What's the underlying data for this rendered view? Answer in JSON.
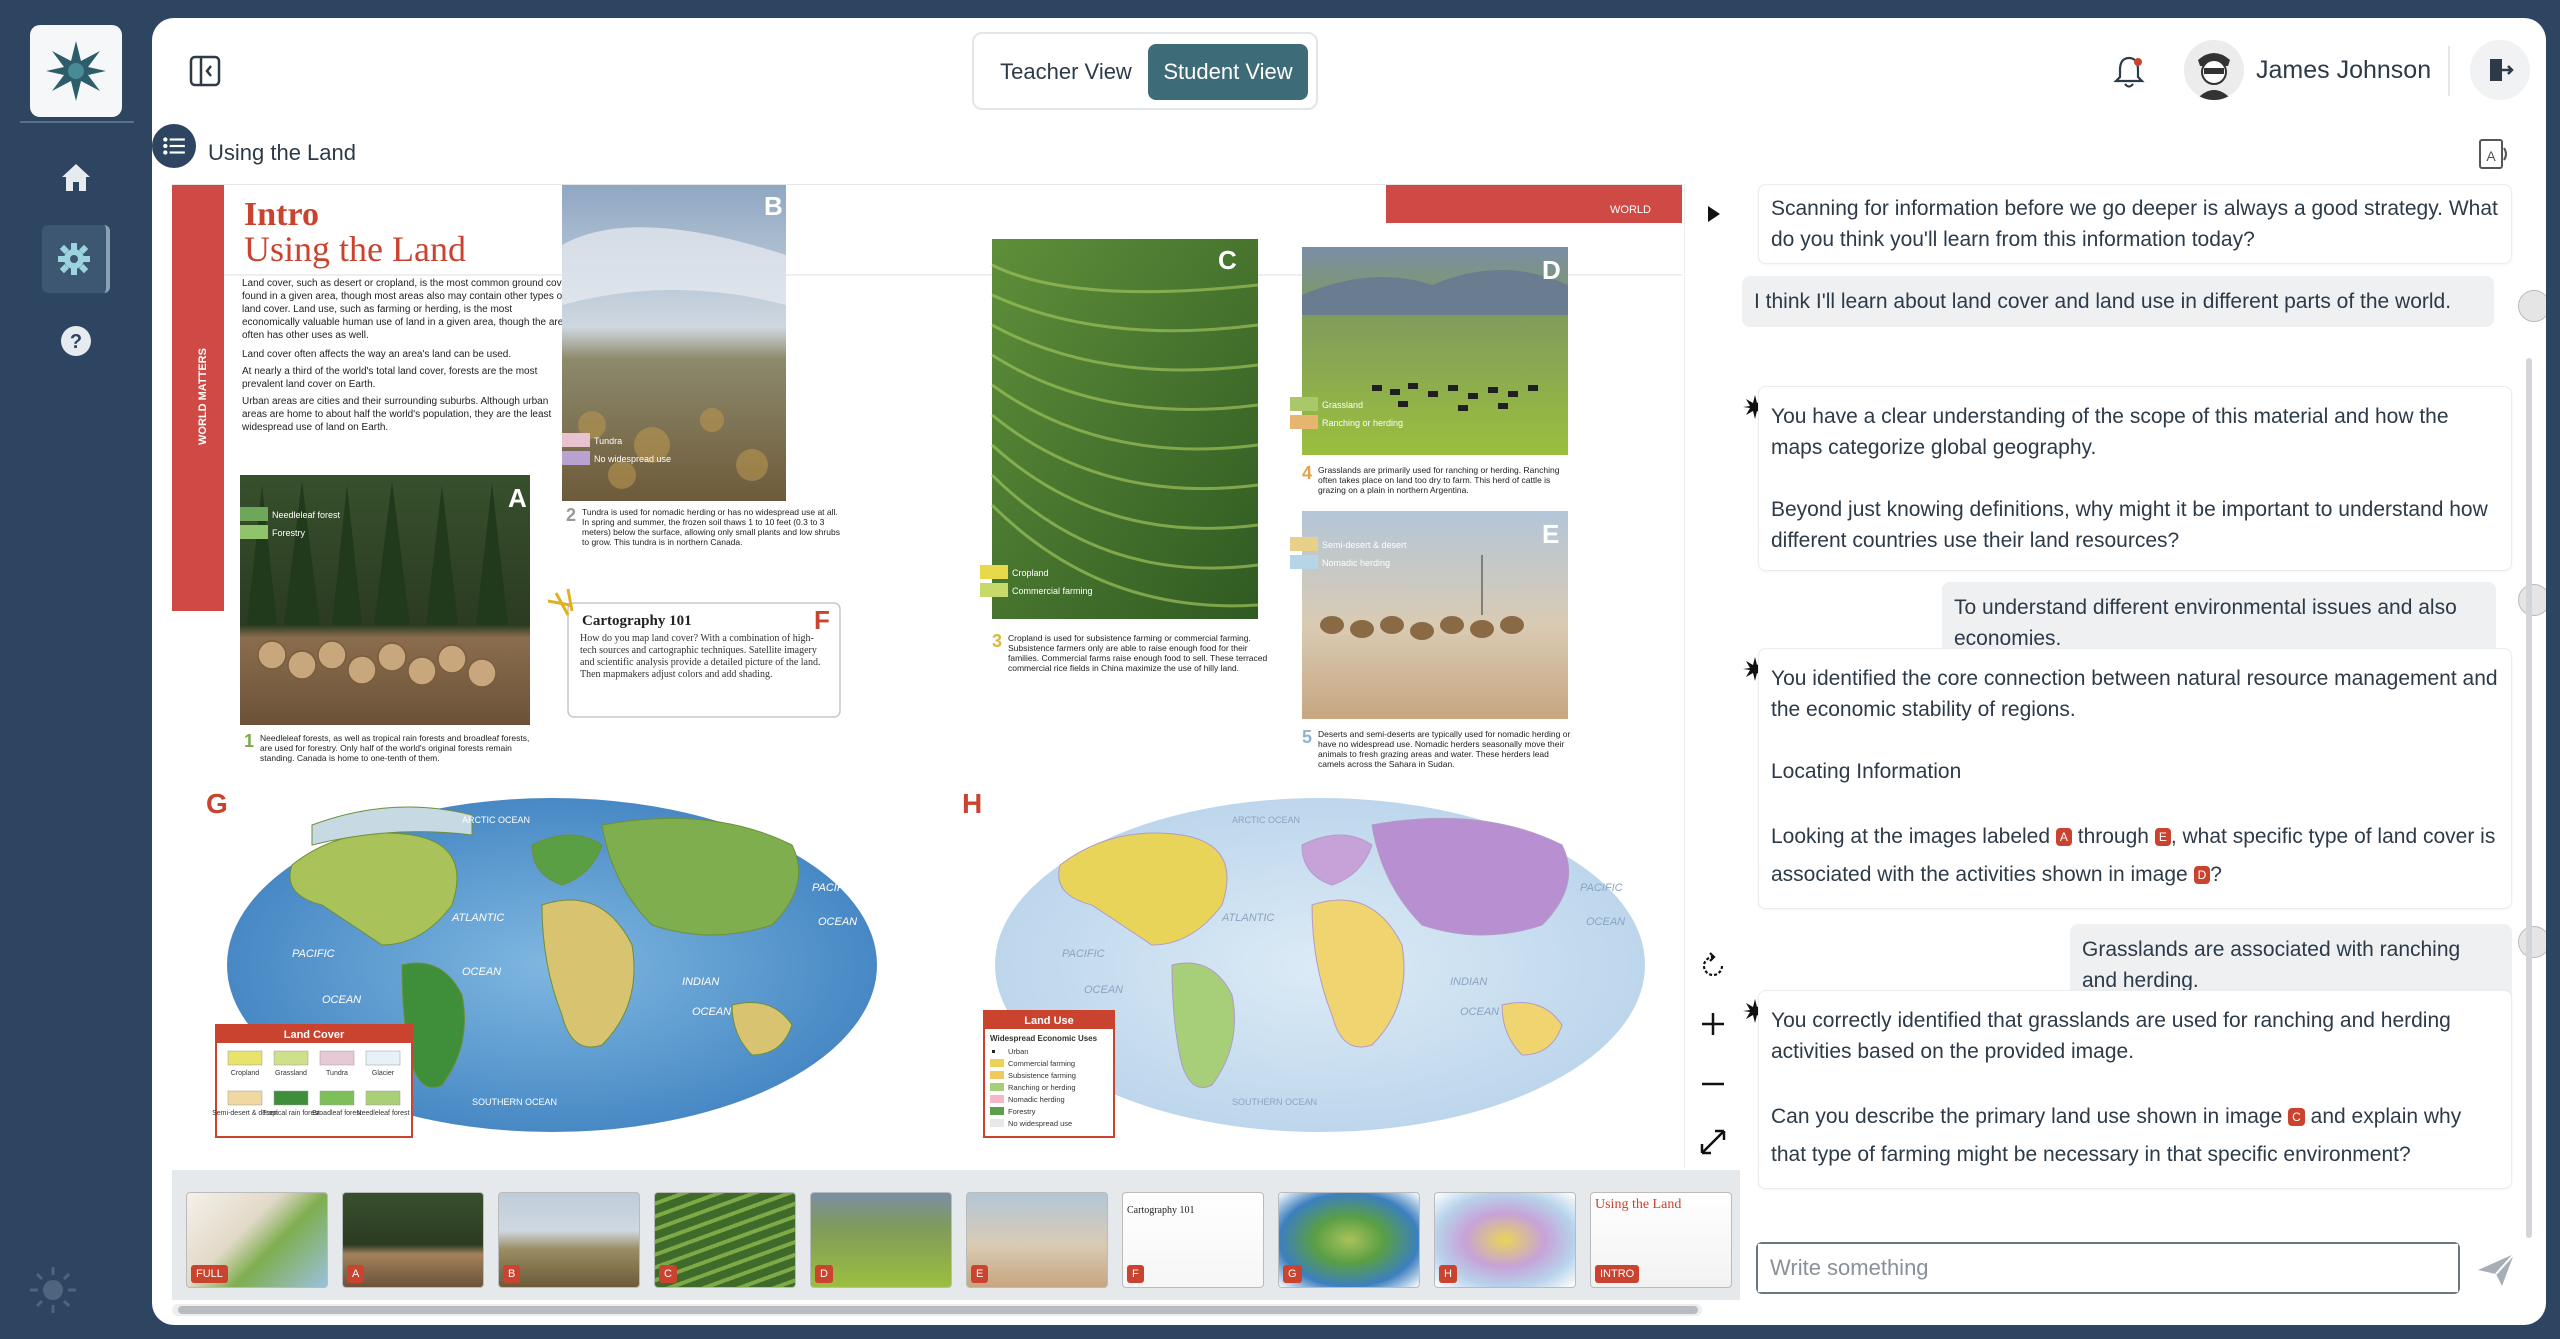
{
  "app": {
    "title": "Using the Land"
  },
  "header": {
    "teacher_view": "Teacher View",
    "student_view": "Student View",
    "user_name": "James Johnson"
  },
  "breadcrumb": {
    "title": "Using the Land"
  },
  "page": {
    "intro_label": "Intro",
    "title": "Using the Land",
    "side_label": "WORLD MATTERS",
    "world_tag": "WORLD",
    "body_text": "Land cover, such as desert or cropland, is the most common ground cover found in a given area, though most areas also may contain other types of land cover. Land use, such as farming or herding, is the most economically valuable human use of land in a given area, though the area often has other uses as well.",
    "bullets": [
      "Land cover often affects the way an area's land can be used.",
      "At nearly a third of the world's total land cover, forests are the most prevalent land cover on Earth.",
      "Urban areas are cities and their surrounding suburbs. Although urban areas are home to about half the world's population, they are the least widespread use of land on Earth."
    ],
    "photos": [
      {
        "letter": "A",
        "legend": [
          "Needleleaf forest",
          "Forestry"
        ],
        "num": "1",
        "caption": "Needleleaf forests, as well as tropical rain forests and broadleaf forests, are used for forestry. Only half of the world's original forests remain standing. Canada is home to one-tenth of them."
      },
      {
        "letter": "B",
        "legend": [
          "Tundra",
          "No widespread use"
        ],
        "num": "2",
        "caption": "Tundra is used for nomadic herding or has no widespread use at all. In spring and summer, the frozen soil thaws 1 to 10 feet (0.3 to 3 meters) below the surface, allowing only small plants and low shrubs to grow. This tundra is in northern Canada."
      },
      {
        "letter": "C",
        "legend": [
          "Cropland",
          "Commercial farming"
        ],
        "num": "3",
        "caption": "Cropland is used for subsistence farming or commercial farming. Subsistence farmers only are able to raise enough food for their families. Commercial farms raise enough food to sell. These terraced commercial rice fields in China maximize the use of hilly land."
      },
      {
        "letter": "D",
        "legend": [
          "Grassland",
          "Ranching or herding"
        ],
        "num": "4",
        "caption": "Grasslands are primarily used for ranching or herding. Ranching often takes place on land too dry to farm. This herd of cattle is grazing on a plain in northern Argentina."
      },
      {
        "letter": "E",
        "legend": [
          "Semi-desert & desert",
          "Nomadic herding"
        ],
        "num": "5",
        "caption": "Deserts and semi-deserts are typically used for nomadic herding or have no widespread use. Nomadic herders seasonally move their animals to fresh grazing areas and water. These herders lead camels across the Sahara in Sudan."
      }
    ],
    "cartography": {
      "letter": "F",
      "title": "Cartography 101",
      "text": "How do you map land cover? With a combination of high-tech sources and cartographic techniques. Satellite imagery and scientific analysis provide a detailed picture of the land. Then mapmakers adjust colors and add shading."
    },
    "map_g": {
      "letter": "G",
      "legend_title": "Land Cover",
      "legend_items": [
        "Cropland",
        "Grassland",
        "Tundra",
        "Glacier",
        "Semi-desert & desert",
        "Tropical rain forest",
        "Broadleaf forest",
        "Needleleaf forest"
      ],
      "labels": {
        "arctic": "ARCTIC OCEAN",
        "atlantic": "ATLANTIC",
        "pacific_w": "PACIFIC",
        "ocean_w": "OCEAN",
        "pacific_e": "PACIFIC",
        "ocean_e": "OCEAN",
        "indian": "INDIAN",
        "ocean_i": "OCEAN",
        "southern": "SOUTHERN OCEAN",
        "ocean_a": "OCEAN"
      }
    },
    "map_h": {
      "letter": "H",
      "legend_title": "Land Use",
      "legend_sub": "Widespread Economic Uses",
      "legend_items": [
        "Urban",
        "Commercial farming",
        "Subsistence farming",
        "Ranching or herding",
        "Nomadic herding",
        "Forestry",
        "No widespread use"
      ],
      "labels": {
        "arctic": "ARCTIC OCEAN",
        "atlantic": "ATLANTIC",
        "pacific_w": "PACIFIC",
        "ocean_w": "OCEAN",
        "pacific_e": "PACIFIC",
        "ocean_e": "OCEAN",
        "indian": "INDIAN",
        "ocean_i": "OCEAN",
        "southern": "SOUTHERN OCEAN"
      }
    }
  },
  "thumbnails": [
    "FULL",
    "A",
    "B",
    "C",
    "D",
    "E",
    "F",
    "G",
    "H",
    "INTRO"
  ],
  "thumb_intro_title": "Using the Land",
  "thumb_f_title": "Cartography 101",
  "chat": {
    "messages": [
      {
        "role": "ai",
        "text": "Scanning for information before we go deeper is always a good strategy. What do you think you'll learn from this information today?"
      },
      {
        "role": "user",
        "text": "I think I'll learn about land cover and land use in different parts of the world."
      },
      {
        "role": "ai",
        "p1": "You have a clear understanding of the scope of this material and how the maps categorize global geography.",
        "p2": "Beyond just knowing definitions, why might it be important to understand how different countries use their land resources?"
      },
      {
        "role": "user",
        "text": "To understand different environmental issues and also economies."
      },
      {
        "role": "ai",
        "p1": "You identified the core connection between natural resource management and the economic stability of regions.",
        "p2": "Locating Information",
        "p3a": "Looking at the images labeled",
        "badge1": "A",
        "p3b": "through",
        "badge2": "E",
        "p3c": ", what specific type of land cover is associated with the activities shown in image",
        "badge3": "D",
        "p3d": "?"
      },
      {
        "role": "user",
        "text": "Grasslands are associated with ranching and herding."
      },
      {
        "role": "ai",
        "p1": "You correctly identified that grasslands are used for ranching and herding activities based on the provided image.",
        "p2a": "Can you describe the primary land use shown in image",
        "badge": "C",
        "p2b": "and explain why that type of farming might be necessary in that specific environment?"
      }
    ],
    "placeholder": "Write something"
  },
  "colors": {
    "accent": "#3d6b78",
    "rail": "#2d4560",
    "badge": "#c9432f"
  }
}
